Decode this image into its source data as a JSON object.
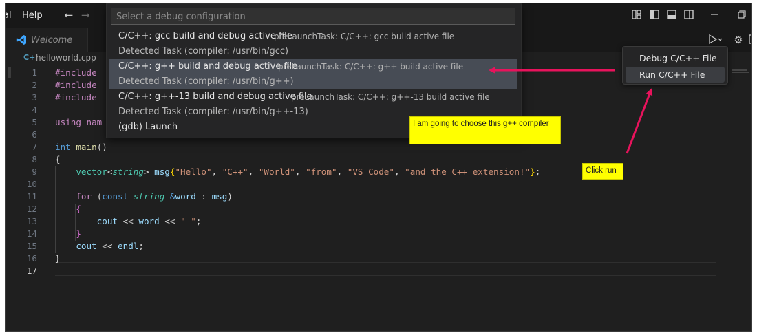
{
  "titlebar": {
    "menu_fragment": "al",
    "help": "Help",
    "back_icon": "arrow-left-icon",
    "forward_icon": "arrow-right-icon",
    "layout_icons": [
      "customize-layout-icon",
      "toggle-primary-sidebar-icon",
      "toggle-panel-icon",
      "toggle-secondary-sidebar-icon"
    ],
    "minimize_icon": "minimize-icon",
    "restore_icon": "restore-icon"
  },
  "tabs": [
    {
      "label": "Welcome",
      "icon": "vscode-icon"
    }
  ],
  "editor_actions": {
    "run_icon": "run-debug-icon",
    "settings_icon": "gear-icon"
  },
  "breadcrumb": {
    "file_icon": "cpp-file-icon",
    "filename": "helloworld.cpp"
  },
  "quick_pick": {
    "placeholder": "Select a debug configuration",
    "items": [
      {
        "label": "C/C++: gcc build and debug active file",
        "description": "preLaunchTask: C/C++: gcc build active file",
        "detail": "Detected Task (compiler: /usr/bin/gcc)"
      },
      {
        "label": "C/C++: g++ build and debug active file",
        "description": "preLaunchTask: C/C++: g++ build active file",
        "detail": "Detected Task (compiler: /usr/bin/g++)",
        "selected": true
      },
      {
        "label": "C/C++: g++-13 build and debug active file",
        "description": "preLaunchTask: C/C++: g++-13 build active file",
        "detail": "Detected Task (compiler: /usr/bin/g++-13)"
      },
      {
        "label": "(gdb) Launch"
      }
    ]
  },
  "run_menu": {
    "items": [
      {
        "label": "Debug C/C++ File"
      },
      {
        "label": "Run C/C++ File",
        "selected": true
      }
    ]
  },
  "annotations": {
    "choose_note": "I am going to choose this g++ compiler",
    "click_note": "Click run",
    "arrow_color": "#e8135c"
  },
  "code": {
    "line_numbers": [
      "1",
      "2",
      "3",
      "4",
      "5",
      "6",
      "7",
      "8",
      "9",
      "10",
      "11",
      "12",
      "13",
      "14",
      "15",
      "16",
      "17"
    ],
    "include": "#include",
    "using_fragment": "using nam",
    "int_kw": "int",
    "main_fn": "main",
    "vector_ty": "vector",
    "string_ty": "string",
    "msg_var": "msg",
    "strings": [
      "\"Hello\"",
      "\"C++\"",
      "\"World\"",
      "\"from\"",
      "\"VS Code\"",
      "\"and the C++ extension!\""
    ],
    "for_kw": "for",
    "const_kw": "const",
    "word_var": "word",
    "cout_var": "cout",
    "space_str": "\" \"",
    "endl_var": "endl"
  },
  "colors": {
    "editor_bg": "#1f1f1f",
    "selection": "#474c55",
    "note_bg": "#ffff00",
    "arrow": "#e8135c"
  }
}
